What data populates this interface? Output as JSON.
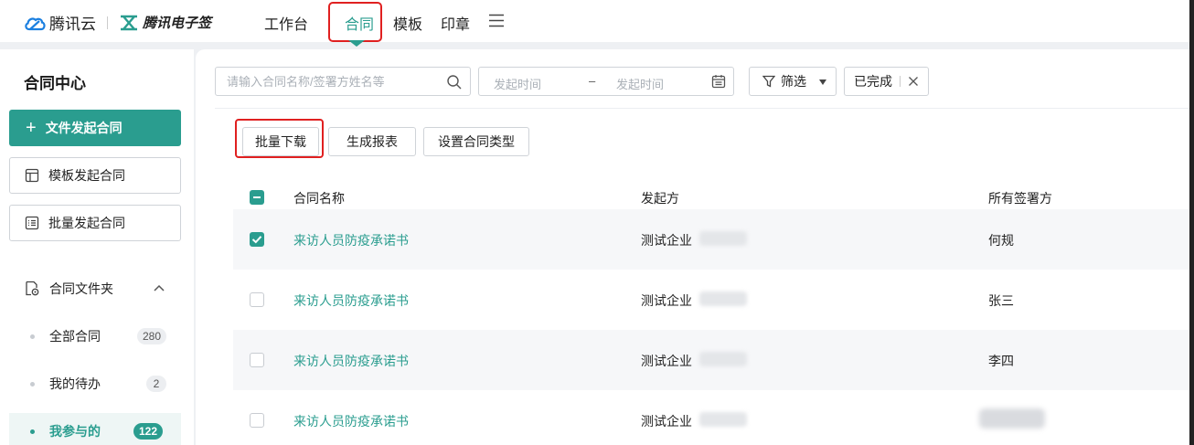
{
  "brand": {
    "cloud_name": "腾讯云",
    "product_name": "腾讯电子签"
  },
  "nav": {
    "items": [
      "工作台",
      "合同",
      "模板",
      "印章"
    ],
    "active_index": 1
  },
  "sidebar": {
    "title": "合同中心",
    "primary_action": "文件发起合同",
    "actions": [
      "模板发起合同",
      "批量发起合同"
    ],
    "folder_label": "合同文件夹",
    "items": [
      {
        "label": "全部合同",
        "count": "280"
      },
      {
        "label": "我的待办",
        "count": "2"
      },
      {
        "label": "我参与的",
        "count": "122"
      }
    ]
  },
  "filters": {
    "search_placeholder": "请输入合同名称/签署方姓名等",
    "date_start_placeholder": "发起时间",
    "date_separator": "–",
    "date_end_placeholder": "发起时间",
    "filter_label": "筛选",
    "status_tag": "已完成"
  },
  "toolbar": {
    "batch_download": "批量下载",
    "generate_report": "生成报表",
    "set_contract_type": "设置合同类型"
  },
  "table": {
    "columns": [
      "合同名称",
      "发起方",
      "所有签署方"
    ],
    "rows": [
      {
        "name": "来访人员防疫承诺书",
        "initiator": "测试企业",
        "signer": "何规",
        "checked": true
      },
      {
        "name": "来访人员防疫承诺书",
        "initiator": "测试企业",
        "signer": "张三",
        "checked": false
      },
      {
        "name": "来访人员防疫承诺书",
        "initiator": "测试企业",
        "signer": "李四",
        "checked": false
      },
      {
        "name": "来访人员防疫承诺书",
        "initiator": "测试企业",
        "signer": "",
        "checked": false
      }
    ]
  },
  "colors": {
    "accent": "#2a9d8f",
    "highlight": "#e02020"
  }
}
